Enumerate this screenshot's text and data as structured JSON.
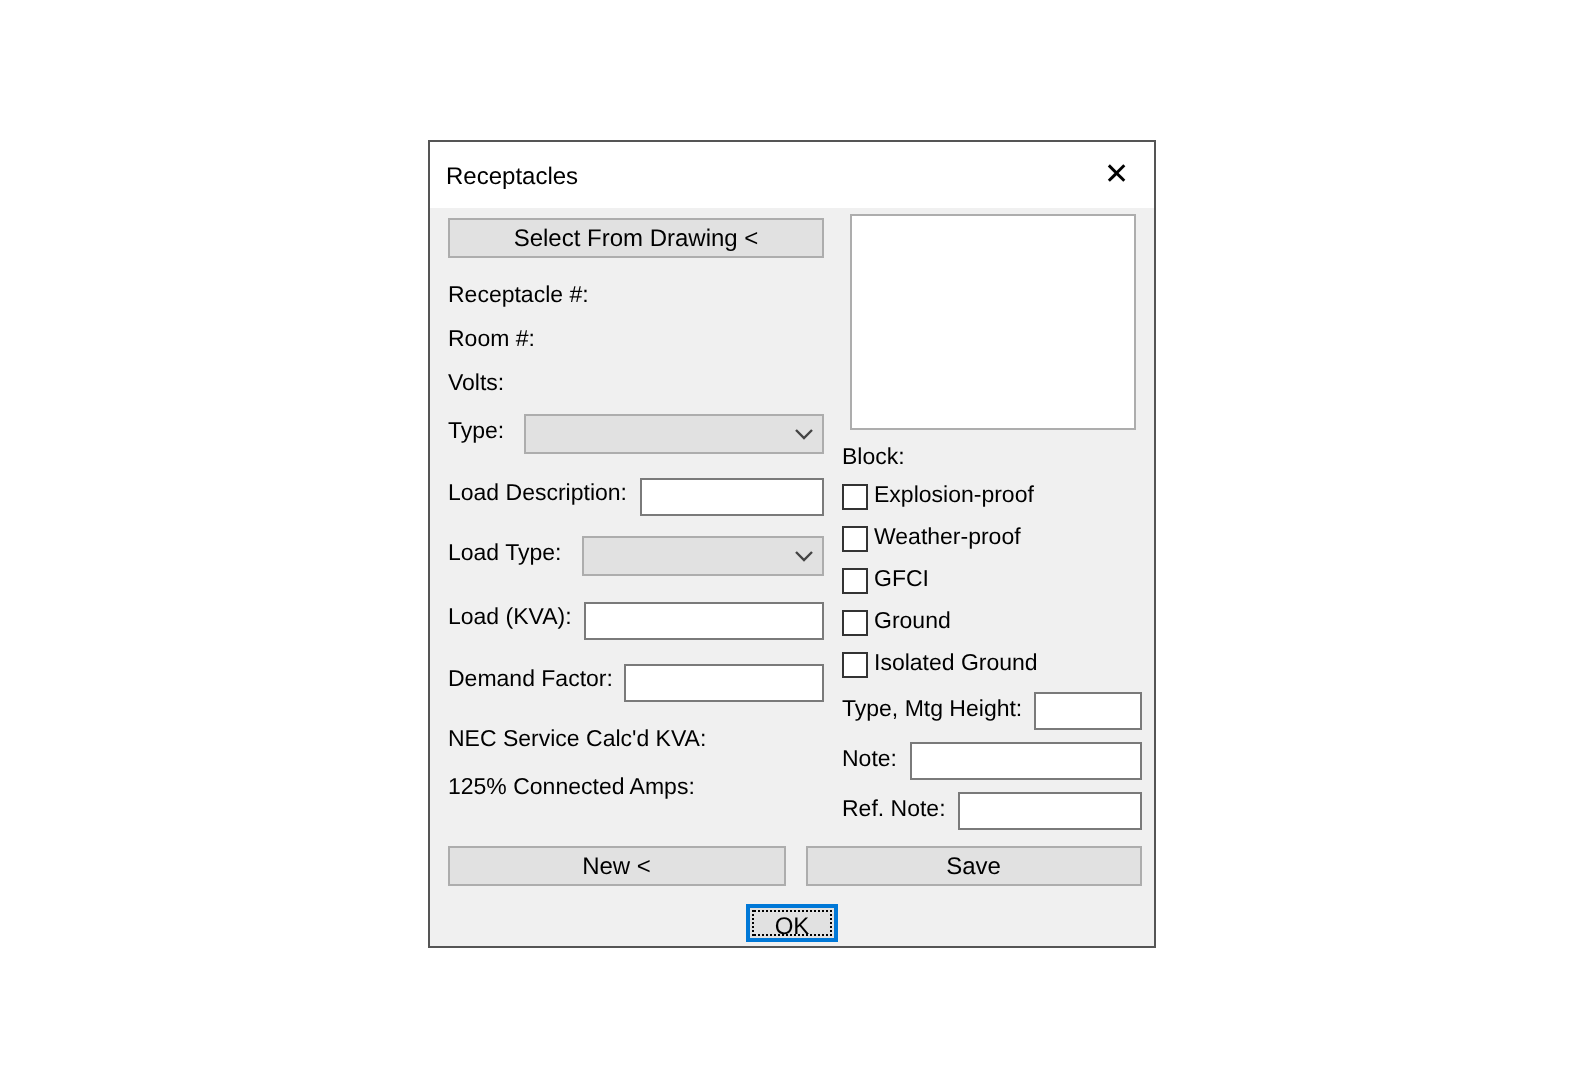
{
  "window": {
    "title": "Receptacles",
    "close": "✕"
  },
  "left": [
    {
      "kind": "button",
      "label": "Select From Drawing <"
    },
    {
      "kind": "label",
      "label": "Receptacle #:"
    },
    {
      "kind": "label",
      "label": "Room #:"
    },
    {
      "kind": "label",
      "label": "Volts:"
    },
    {
      "kind": "select",
      "label": "Type:"
    },
    {
      "kind": "input",
      "label": "Load Description:"
    },
    {
      "kind": "select",
      "label": "Load Type:"
    },
    {
      "kind": "input",
      "label": "Load (KVA):"
    },
    {
      "kind": "input",
      "label": "Demand Factor:"
    },
    {
      "kind": "label",
      "label": "NEC Service Calc'd KVA:"
    },
    {
      "kind": "label",
      "label": "125% Connected Amps:"
    }
  ],
  "block": {
    "label": "Block:",
    "options": [
      {
        "label": "Explosion-proof",
        "checked": false
      },
      {
        "label": "Weather-proof",
        "checked": false
      },
      {
        "label": "GFCI",
        "checked": false
      },
      {
        "label": "Ground",
        "checked": false
      },
      {
        "label": "Isolated Ground",
        "checked": false
      }
    ]
  },
  "right_fields": [
    {
      "label": "Type, Mtg Height:"
    },
    {
      "label": "Note:"
    },
    {
      "label": "Ref. Note:"
    }
  ],
  "buttons": [
    {
      "label": "New <"
    },
    {
      "label": "Save"
    }
  ],
  "ok": {
    "label": "OK"
  }
}
